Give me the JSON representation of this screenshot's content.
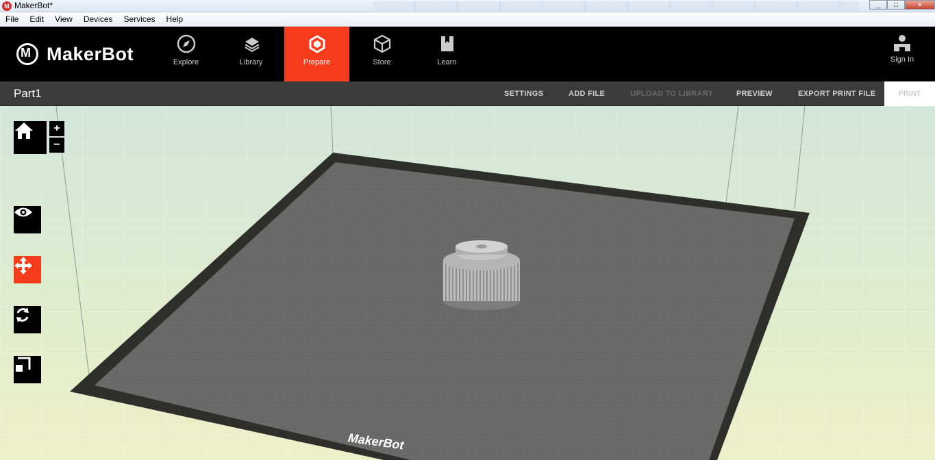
{
  "window": {
    "title": "MakerBot*",
    "app_icon": "makerbot-logo-icon"
  },
  "menu": {
    "items": [
      "File",
      "Edit",
      "View",
      "Devices",
      "Services",
      "Help"
    ]
  },
  "nav": {
    "logo_text": "MakerBot",
    "tabs": [
      {
        "label": "Explore",
        "icon": "compass-icon"
      },
      {
        "label": "Library",
        "icon": "library-icon"
      },
      {
        "label": "Prepare",
        "icon": "prepare-icon",
        "active": true
      },
      {
        "label": "Store",
        "icon": "box-icon"
      },
      {
        "label": "Learn",
        "icon": "book-icon"
      }
    ],
    "sign_in": "Sign In"
  },
  "toolbar": {
    "project_name": "Part1",
    "settings": "SETTINGS",
    "add_file": "ADD FILE",
    "upload_to_library": "UPLOAD TO LIBRARY",
    "preview": "PREVIEW",
    "export_print_file": "EXPORT PRINT FILE",
    "print": "PRINT"
  },
  "viewport": {
    "zoom_in": "+",
    "zoom_out": "−",
    "tools": [
      "home-icon",
      "eye-icon",
      "move-icon",
      "rotate-icon",
      "scale-icon"
    ],
    "active_tool": "move-icon",
    "plate_brand_text": "MakerBot",
    "accent_color": "#f73b1d"
  }
}
